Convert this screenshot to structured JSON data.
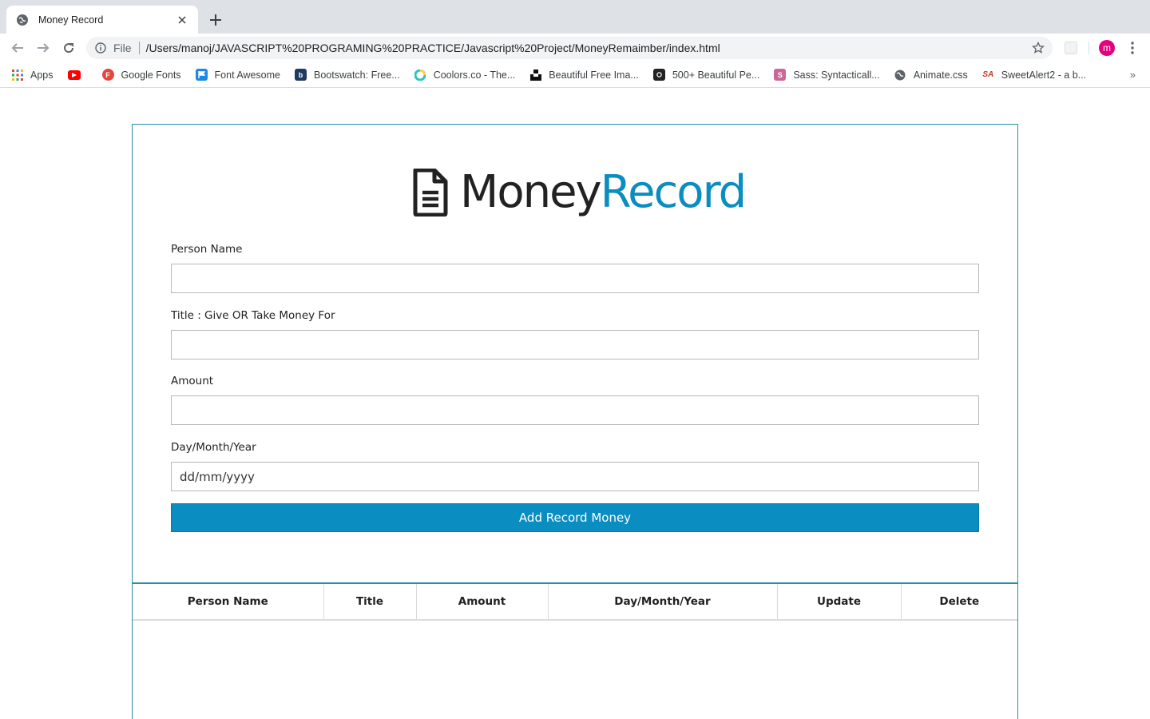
{
  "browser": {
    "tab_title": "Money Record",
    "omnibox_scheme": "File",
    "url": "/Users/manoj/JAVASCRIPT%20PROGRAMING%20PRACTICE/Javascript%20Project/MoneyRemaimber/index.html",
    "profile_initial": "m",
    "bookmarks": [
      {
        "label": "Apps",
        "icon": "apps-grid-icon"
      },
      {
        "label": "",
        "icon": "youtube-icon"
      },
      {
        "label": "Google Fonts",
        "icon": "google-fonts-icon"
      },
      {
        "label": "Font Awesome",
        "icon": "font-awesome-icon"
      },
      {
        "label": "Bootswatch: Free...",
        "icon": "bootswatch-icon"
      },
      {
        "label": "Coolors.co - The...",
        "icon": "coolors-icon"
      },
      {
        "label": "Beautiful Free Ima...",
        "icon": "unsplash-icon"
      },
      {
        "label": "500+ Beautiful Pe...",
        "icon": "camera-icon"
      },
      {
        "label": "Sass: Syntacticall...",
        "icon": "sass-icon"
      },
      {
        "label": "Animate.css",
        "icon": "globe-icon"
      },
      {
        "label": "SweetAlert2 - a b...",
        "icon": "sweetalert-icon"
      }
    ],
    "more_bookmarks": "»"
  },
  "app": {
    "logo_word1": "Money",
    "logo_word2": "Record",
    "fields": {
      "person_name_label": "Person Name",
      "title_label": "Title : Give OR Take Money For",
      "amount_label": "Amount",
      "date_label": "Day/Month/Year",
      "date_placeholder": "dd/mm/yyyy"
    },
    "submit_label": "Add Record Money",
    "table_headers": [
      "Person Name",
      "Title",
      "Amount",
      "Day/Month/Year",
      "Update",
      "Delete"
    ]
  },
  "colors": {
    "accent": "#0a8dc0",
    "card_border": "#2b8ea8",
    "profile": "#e6007e"
  }
}
